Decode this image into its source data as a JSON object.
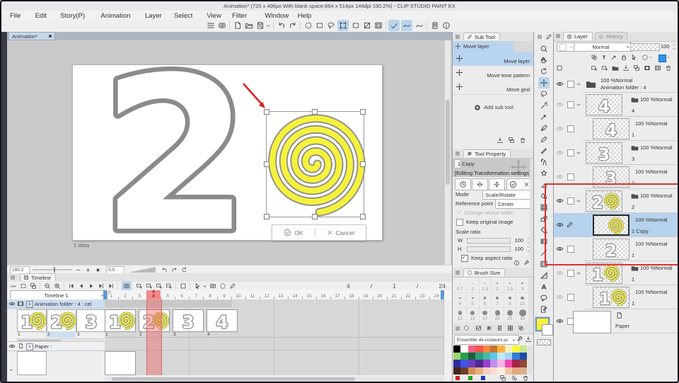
{
  "window": {
    "title": "Animation* (720 x 406px With blank space:864 x 514px 144dpi 150.2%) - CLIP STUDIO PAINT EX"
  },
  "menu": {
    "items": [
      "File",
      "Edit",
      "Story(P)",
      "Animation",
      "Layer",
      "Select",
      "View",
      "Filter",
      "Window",
      "Help"
    ]
  },
  "document_tab": {
    "label": "Animation*"
  },
  "canvas": {
    "numeral": "2",
    "story_label": "1 story",
    "ok_label": "OK",
    "cancel_label": "Cancel"
  },
  "navigation": {
    "zoom_value": "150.2",
    "rotate_value": "0.0"
  },
  "sub_tool": {
    "title": "Sub Tool",
    "group_label": "Move layer",
    "items": [
      {
        "label": "Move layer",
        "selected": true
      },
      {
        "label": "Move tone pattern",
        "selected": false
      },
      {
        "label": "Move grid",
        "selected": false
      }
    ],
    "add_label": "Add sub tool"
  },
  "tool_property": {
    "title": "Tool Property",
    "tool_name": "1 Copy",
    "status": "[Editing Transformation settings]",
    "mode_label": "Mode",
    "mode_value": "Scale/Rotate",
    "reference_label": "Reference point",
    "reference_value": "Center",
    "change_vector_label": "Change vector width",
    "keep_original_label": "Keep original image",
    "scale_ratio_label": "Scale ratio",
    "w_label": "W",
    "w_value": "100",
    "h_label": "H",
    "h_value": "100",
    "keep_aspect_label": "Keep aspect ratio"
  },
  "brush_size": {
    "title": "Brush Size",
    "sizes": [
      "0.7",
      "1",
      "1.5",
      "2",
      "2.5",
      "3",
      "4",
      "5",
      "6",
      "7",
      "8",
      "10",
      "12",
      "15",
      "17",
      "20",
      "25",
      "30"
    ]
  },
  "color_set": {
    "name": "Ensemble de couleurs par défaut",
    "rows": [
      [
        "#000000",
        "#ffffff",
        "#f26088",
        "#f8564a",
        "#f98840",
        "#c4762c",
        "#f9b33f",
        "#faf3c0",
        "#f8f840",
        "#c9e693"
      ],
      [
        "#9fd66e",
        "#2ba04f",
        "#17603d",
        "#2aa384",
        "#41bca4",
        "#57c8ee",
        "#bfeaf8",
        "#a5d5f3",
        "#2e7de0",
        "#1c4ba8"
      ],
      [
        "#2b2f9e",
        "#4453ea",
        "#6f3bbf",
        "#4f2694",
        "#9340cc",
        "#bf8fe8",
        "#f2b5ea",
        "#f146b2",
        "#a42448",
        "#8f4a36"
      ],
      [
        "#44251a",
        "#6e4026",
        "#d79058",
        "#e7b084",
        "#f6cfc0",
        "#f9dcd2",
        "#fcefe2",
        "#efc69e",
        "#e0a87e",
        "#d6b193"
      ]
    ],
    "markers": [
      "#cc2222",
      "#22a022",
      "#2038c8"
    ]
  },
  "timeline": {
    "title": "Timeline",
    "timeline_name": "Timeline 1",
    "zero_label": "0",
    "current_frame": "4",
    "frames": [
      "1",
      "2",
      "3",
      "4",
      "5",
      "6",
      "7",
      "8",
      "9",
      "10",
      "11",
      "12",
      "13",
      "14",
      "15",
      "16",
      "17",
      "18",
      "19",
      "20",
      "21",
      "22",
      "23",
      "24"
    ],
    "frame_display": [
      "4",
      "/",
      "1",
      "/",
      "24"
    ],
    "animation_track": {
      "label": "Animation folder : 4 : cel",
      "header_cels": [
        {
          "num": "1",
          "spiral": true
        },
        {
          "num": "2",
          "spiral": true
        },
        {
          "num": "3",
          "spiral": false
        }
      ],
      "cels": [
        {
          "num": "1",
          "spiral": true
        },
        {
          "num": "2",
          "spiral": true
        },
        {
          "num": "3",
          "spiral": false
        },
        {
          "num": "4",
          "spiral": false
        }
      ]
    },
    "paper_track": {
      "label": "Paper :"
    }
  },
  "layer_panel": {
    "tab_layer": "Layer",
    "tab_history": "History",
    "blend_mode": "Normal",
    "opacity_value": "100",
    "rows": [
      {
        "kind": "folder-top",
        "eye": true,
        "info": "100 %Normal",
        "name": "Animation folder : 4"
      },
      {
        "kind": "folder",
        "eye": false,
        "thumb_num": "4",
        "spiral": false,
        "info": "100 %Normal",
        "name": "4"
      },
      {
        "kind": "layer",
        "eye": false,
        "thumb_num": "4",
        "spiral": false,
        "info": "100 %Normal",
        "name": "1"
      },
      {
        "kind": "folder",
        "eye": false,
        "thumb_num": "3",
        "spiral": false,
        "info": "100 %Normal",
        "name": "3"
      },
      {
        "kind": "layer",
        "eye": false,
        "thumb_num": "3",
        "spiral": false,
        "info": "100 %Normal",
        "name": "1"
      },
      {
        "kind": "folder",
        "eye": true,
        "thumb_num": "2",
        "spiral": true,
        "info": "100 %Normal",
        "name": "2"
      },
      {
        "kind": "layer",
        "eye": true,
        "selected": true,
        "editing": true,
        "thumb_num": "",
        "spiral": true,
        "info": "100 %Normal",
        "name": "1 Copy"
      },
      {
        "kind": "layer",
        "eye": true,
        "thumb_num": "2",
        "spiral": false,
        "info": "100 %Normal",
        "name": "1"
      },
      {
        "kind": "folder",
        "eye": false,
        "thumb_num": "1",
        "spiral": true,
        "info": "100 %Normal",
        "name": "1"
      },
      {
        "kind": "layer",
        "eye": false,
        "thumb_num": "1",
        "spiral": true,
        "info": "100 %Normal",
        "name": "1"
      },
      {
        "kind": "paper",
        "eye": true,
        "name": "Paper"
      }
    ]
  }
}
